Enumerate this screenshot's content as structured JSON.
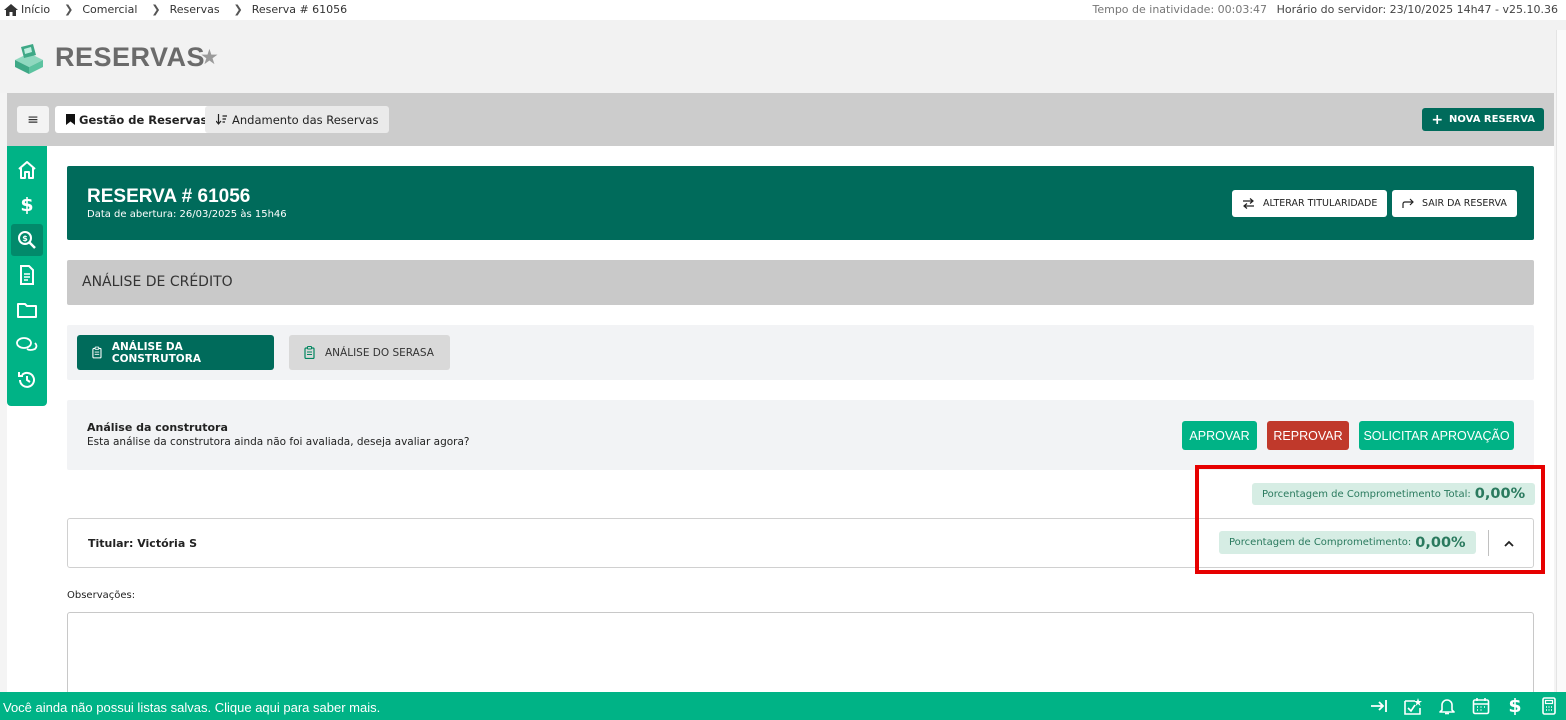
{
  "breadcrumb": {
    "items": [
      "Início",
      "Comercial",
      "Reservas",
      "Reserva # 61056"
    ]
  },
  "server": {
    "idle_label": "Tempo de inatividade: 00:03:47",
    "server_label": "Horário do servidor: 23/10/2025 14h47 - v25.10.36"
  },
  "page": {
    "title": "RESERVAS"
  },
  "tabs": {
    "gestao": "Gestão de Reservas",
    "andamento": "Andamento das Reservas",
    "new_button": "NOVA RESERVA"
  },
  "reserva": {
    "title": "RESERVA # 61056",
    "opened": "Data de abertura: 26/03/2025 às 15h46",
    "btn_alterar": "ALTERAR TITULARIDADE",
    "btn_sair": "SAIR DA RESERVA"
  },
  "section": {
    "heading": "ANÁLISE DE CRÉDITO"
  },
  "analysis_tabs": {
    "construtora": "ANÁLISE DA CONSTRUTORA",
    "serasa": "ANÁLISE DO SERASA"
  },
  "analysis": {
    "title": "Análise da construtora",
    "description": "Esta análise da construtora ainda não foi avaliada, deseja avaliar agora?",
    "btn_aprovar": "APROVAR",
    "btn_reprovar": "REPROVAR",
    "btn_solicitar": "SOLICITAR APROVAÇÃO"
  },
  "commitment": {
    "total_label": "Porcentagem de Comprometimento Total:",
    "total_value": "0,00%",
    "row_label": "Porcentagem de Comprometimento:",
    "row_value": "0,00%"
  },
  "titular": {
    "label": "Titular: Victória S"
  },
  "observations": {
    "label": "Observações:"
  },
  "footer": {
    "message": "Você ainda não possui listas salvas. Clique aqui para saber mais."
  },
  "colors": {
    "primary_dark": "#006b5b",
    "primary": "#00b386",
    "danger": "#c0392b",
    "highlight": "#e60000"
  }
}
